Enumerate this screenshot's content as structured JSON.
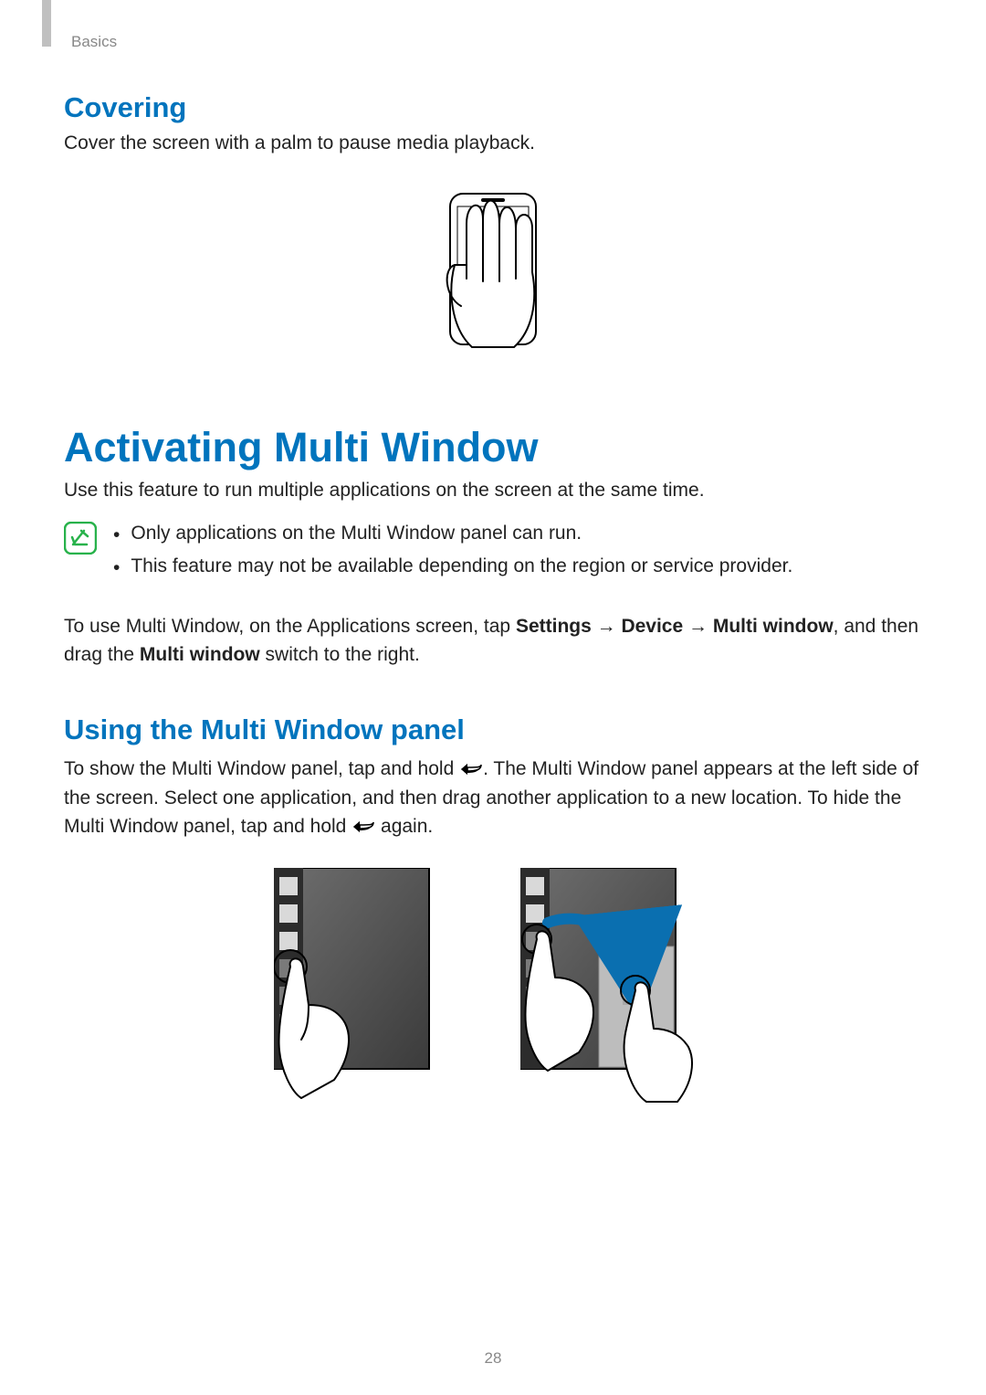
{
  "header": {
    "chapter": "Basics"
  },
  "covering": {
    "title": "Covering",
    "text": "Cover the screen with a palm to pause media playback."
  },
  "multiwindow": {
    "title": "Activating Multi Window",
    "intro": "Use this feature to run multiple applications on the screen at the same time.",
    "notes": {
      "items": [
        "Only applications on the Multi Window panel can run.",
        "This feature may not be available depending on the region or service provider."
      ]
    },
    "instructions": {
      "pre": "To use Multi Window, on the Applications screen, tap ",
      "path1": "Settings",
      "arrow": " → ",
      "path2": "Device",
      "path3": "Multi window",
      "mid": ", and then drag the ",
      "switch": "Multi window",
      "post": " switch to the right."
    }
  },
  "panel": {
    "title": "Using the Multi Window panel",
    "line1a": "To show the Multi Window panel, tap and hold ",
    "line1b": ". The Multi Window panel appears at the left side of the screen. Select one application, and then drag another application to a new location. To hide the Multi Window panel, tap and hold ",
    "line1c": " again."
  },
  "icons": {
    "note": "note-icon",
    "back": "back-icon"
  },
  "page_number": "28"
}
